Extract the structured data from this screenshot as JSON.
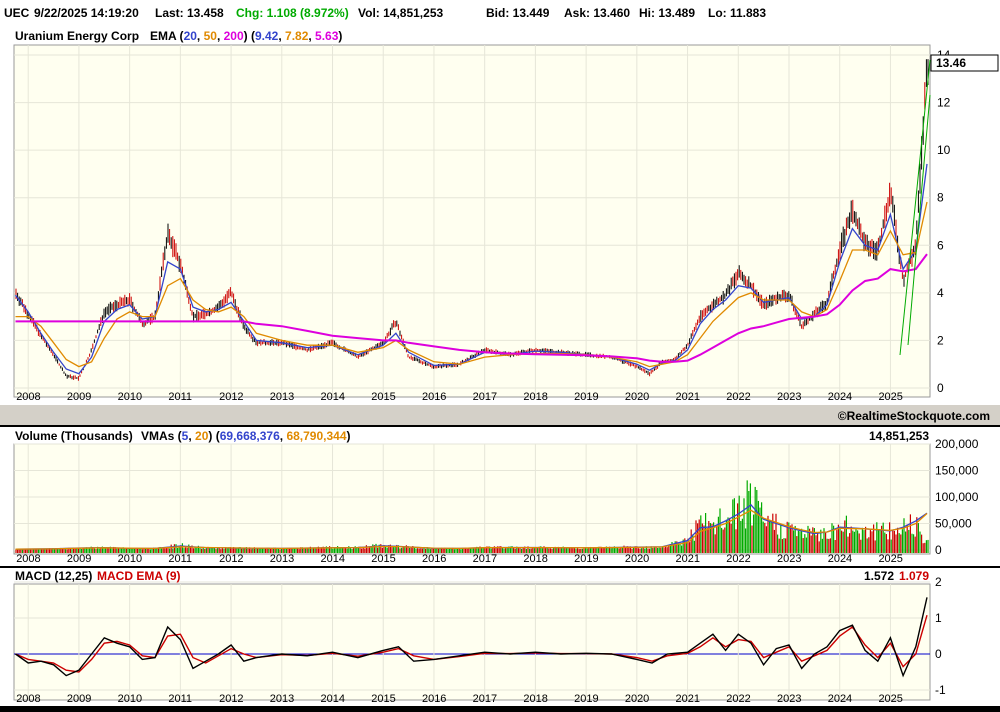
{
  "header": {
    "symbol": "UEC",
    "datetime": "9/22/2025 14:19:20",
    "last": "Last: 13.458",
    "chg": "Chg: 1.108 (8.972%)",
    "vol": "Vol: 14,851,253",
    "bid": "Bid: 13.449",
    "ask": "Ask: 13.460",
    "hi": "Hi: 13.489",
    "lo": "Lo: 11.883"
  },
  "colors": {
    "up": "#00aa00",
    "down": "#cc0000",
    "bar": "#000000",
    "ema20": "#3344cc",
    "ema50": "#e08a00",
    "ema200": "#dd00dd",
    "macd": "#000000",
    "macd_signal": "#cc0000",
    "zero_line": "#0000cc",
    "divider": "#d4d0c8"
  },
  "price_panel": {
    "company": "Uranium Energy Corp",
    "ema_label": "EMA (",
    "ema_periods": [
      "20",
      "50",
      "200"
    ],
    "ema_values": [
      "9.42",
      "7.82",
      "5.63"
    ],
    "last_price_tag": "13.46",
    "y_ticks": [
      "0",
      "2",
      "4",
      "6",
      "8",
      "10",
      "12",
      "14"
    ]
  },
  "copyright": "©RealtimeStockquote.com",
  "volume_panel": {
    "title": "Volume (Thousands)",
    "vma_label": "VMAs (",
    "vma_periods": [
      "5",
      "20"
    ],
    "vma_values": [
      "69,668,376",
      "68,790,344"
    ],
    "last_volume": "14,851,253",
    "y_ticks": [
      "0",
      "50,000",
      "100,000",
      "150,000",
      "200,000"
    ]
  },
  "macd_panel": {
    "title": "MACD (12,25)",
    "signal_label": "MACD EMA (9)",
    "macd_value": "1.572",
    "signal_value": "1.079",
    "y_ticks": [
      "-1",
      "0",
      "1",
      "2"
    ]
  },
  "x_years": [
    "2008",
    "2009",
    "2010",
    "2011",
    "2012",
    "2013",
    "2014",
    "2015",
    "2016",
    "2017",
    "2018",
    "2019",
    "2020",
    "2021",
    "2022",
    "2023",
    "2024",
    "2025"
  ],
  "chart_data": [
    {
      "type": "line",
      "title": "Uranium Energy Corp",
      "x": [
        2007.75,
        2008.0,
        2008.25,
        2008.5,
        2008.75,
        2009.0,
        2009.25,
        2009.5,
        2009.75,
        2010.0,
        2010.25,
        2010.5,
        2010.75,
        2011.0,
        2011.25,
        2011.5,
        2011.75,
        2012.0,
        2012.25,
        2012.5,
        2013.0,
        2013.5,
        2014.0,
        2014.5,
        2015.0,
        2015.25,
        2015.5,
        2016.0,
        2016.5,
        2017.0,
        2017.5,
        2018.0,
        2018.5,
        2019.0,
        2019.5,
        2020.0,
        2020.25,
        2020.5,
        2020.75,
        2021.0,
        2021.25,
        2021.5,
        2021.75,
        2022.0,
        2022.25,
        2022.5,
        2022.75,
        2023.0,
        2023.25,
        2023.5,
        2023.75,
        2024.0,
        2024.25,
        2024.5,
        2024.75,
        2025.0,
        2025.25,
        2025.5,
        2025.72
      ],
      "ylim": [
        0,
        14
      ],
      "series": [
        {
          "name": "Price",
          "values": [
            4.0,
            3.1,
            2.2,
            1.4,
            0.5,
            0.4,
            1.6,
            3.2,
            3.5,
            3.7,
            2.7,
            3.0,
            6.5,
            5.2,
            3.0,
            3.1,
            3.4,
            4.0,
            2.6,
            1.9,
            1.9,
            1.6,
            1.9,
            1.3,
            1.9,
            2.8,
            1.3,
            0.9,
            1.0,
            1.6,
            1.4,
            1.6,
            1.5,
            1.4,
            1.3,
            0.9,
            0.6,
            1.1,
            1.2,
            1.8,
            3.0,
            3.5,
            3.9,
            4.8,
            4.3,
            3.5,
            3.8,
            3.9,
            2.6,
            3.1,
            3.6,
            5.8,
            7.5,
            6.0,
            5.8,
            8.3,
            4.5,
            6.0,
            13.46
          ]
        },
        {
          "name": "EMA 20",
          "values": [
            3.9,
            3.2,
            2.3,
            1.5,
            0.8,
            0.6,
            1.3,
            2.8,
            3.3,
            3.5,
            2.9,
            3.0,
            5.3,
            5.0,
            3.4,
            3.2,
            3.3,
            3.6,
            2.8,
            2.0,
            1.9,
            1.7,
            1.8,
            1.4,
            1.8,
            2.3,
            1.5,
            0.95,
            1.0,
            1.5,
            1.4,
            1.55,
            1.5,
            1.4,
            1.3,
            1.0,
            0.75,
            1.05,
            1.15,
            1.6,
            2.7,
            3.3,
            3.7,
            4.3,
            4.2,
            3.6,
            3.7,
            3.8,
            2.9,
            3.0,
            3.5,
            5.3,
            6.7,
            6.0,
            5.8,
            7.3,
            5.0,
            5.8,
            9.42
          ]
        },
        {
          "name": "EMA 50",
          "values": [
            3.0,
            3.0,
            2.6,
            1.9,
            1.2,
            0.9,
            1.1,
            2.1,
            2.9,
            3.2,
            3.0,
            3.0,
            4.3,
            4.6,
            3.7,
            3.3,
            3.2,
            3.4,
            3.0,
            2.3,
            2.0,
            1.8,
            1.8,
            1.5,
            1.7,
            2.0,
            1.6,
            1.1,
            1.0,
            1.3,
            1.4,
            1.45,
            1.45,
            1.4,
            1.3,
            1.1,
            0.9,
            1.0,
            1.1,
            1.4,
            2.1,
            2.8,
            3.3,
            3.8,
            4.0,
            3.7,
            3.7,
            3.7,
            3.2,
            3.0,
            3.3,
            4.5,
            5.8,
            5.8,
            5.6,
            6.6,
            5.6,
            5.7,
            7.82
          ]
        },
        {
          "name": "EMA 200",
          "values": [
            2.8,
            2.8,
            2.8,
            2.8,
            2.8,
            2.8,
            2.8,
            2.8,
            2.8,
            2.8,
            2.8,
            2.8,
            2.8,
            2.8,
            2.8,
            2.8,
            2.8,
            2.8,
            2.8,
            2.7,
            2.6,
            2.4,
            2.2,
            2.1,
            2.0,
            2.0,
            1.9,
            1.75,
            1.6,
            1.5,
            1.45,
            1.42,
            1.4,
            1.38,
            1.33,
            1.25,
            1.15,
            1.1,
            1.1,
            1.15,
            1.4,
            1.7,
            2.0,
            2.3,
            2.5,
            2.6,
            2.75,
            2.9,
            2.95,
            3.0,
            3.1,
            3.5,
            4.1,
            4.5,
            4.6,
            5.0,
            4.9,
            5.0,
            5.63
          ]
        }
      ]
    },
    {
      "type": "bar",
      "title": "Volume (Thousands)",
      "x": [
        2007.75,
        2008.5,
        2009.0,
        2009.5,
        2010.0,
        2010.5,
        2011.0,
        2011.5,
        2012.0,
        2013.0,
        2014.0,
        2014.5,
        2015.0,
        2015.3,
        2016.0,
        2016.5,
        2017.0,
        2018.0,
        2019.0,
        2020.0,
        2020.5,
        2021.0,
        2021.25,
        2021.5,
        2021.75,
        2022.0,
        2022.25,
        2022.5,
        2022.75,
        2023.0,
        2023.25,
        2023.5,
        2023.75,
        2024.0,
        2024.5,
        2025.0,
        2025.25,
        2025.5,
        2025.72
      ],
      "ylim": [
        0,
        200000
      ],
      "series": [
        {
          "name": "Volume",
          "values": [
            1500,
            2500,
            4000,
            5000,
            3000,
            3000,
            9000,
            4000,
            4000,
            3000,
            5000,
            5000,
            9000,
            7000,
            3000,
            3000,
            5000,
            5000,
            4000,
            6000,
            6000,
            20000,
            50000,
            45000,
            60000,
            75000,
            95000,
            55000,
            50000,
            40000,
            35000,
            30000,
            35000,
            45000,
            40000,
            35000,
            45000,
            60000,
            14851
          ]
        },
        {
          "name": "VMA 5",
          "values": [
            1500,
            2300,
            3800,
            4600,
            3200,
            3000,
            7500,
            4500,
            3800,
            3000,
            4600,
            4800,
            8000,
            6800,
            3200,
            3000,
            4600,
            4700,
            4000,
            5500,
            6000,
            18000,
            42000,
            44000,
            55000,
            68000,
            85000,
            58000,
            50000,
            42000,
            36000,
            31000,
            34000,
            43000,
            40000,
            36000,
            43000,
            55000,
            69668
          ]
        },
        {
          "name": "VMA 20",
          "values": [
            1500,
            2100,
            3400,
            4200,
            3400,
            3100,
            6000,
            4800,
            3900,
            3100,
            4200,
            4600,
            6800,
            6500,
            3500,
            3100,
            4300,
            4500,
            4100,
            5000,
            5800,
            14000,
            35000,
            42000,
            50000,
            62000,
            75000,
            60000,
            52000,
            44000,
            38000,
            33000,
            34000,
            41000,
            40000,
            37000,
            41000,
            50000,
            68790
          ]
        }
      ]
    },
    {
      "type": "line",
      "title": "MACD (12,25)",
      "x": [
        2007.75,
        2008.0,
        2008.25,
        2008.5,
        2008.75,
        2009.0,
        2009.25,
        2009.5,
        2009.75,
        2010.0,
        2010.25,
        2010.5,
        2010.75,
        2011.0,
        2011.25,
        2011.5,
        2011.75,
        2012.0,
        2012.25,
        2012.5,
        2013.0,
        2013.5,
        2014.0,
        2014.5,
        2015.0,
        2015.3,
        2015.6,
        2016.0,
        2016.5,
        2017.0,
        2017.5,
        2018.0,
        2018.5,
        2019.0,
        2019.5,
        2020.0,
        2020.3,
        2020.6,
        2021.0,
        2021.25,
        2021.5,
        2021.75,
        2022.0,
        2022.25,
        2022.5,
        2022.75,
        2023.0,
        2023.25,
        2023.5,
        2023.75,
        2024.0,
        2024.25,
        2024.5,
        2024.75,
        2025.0,
        2025.25,
        2025.5,
        2025.72
      ],
      "ylim": [
        -1,
        2
      ],
      "series": [
        {
          "name": "MACD",
          "values": [
            0.0,
            -0.25,
            -0.2,
            -0.3,
            -0.6,
            -0.45,
            0.0,
            0.45,
            0.3,
            0.2,
            -0.15,
            -0.1,
            0.75,
            0.4,
            -0.4,
            -0.2,
            0.0,
            0.25,
            -0.2,
            -0.1,
            0.0,
            -0.05,
            0.05,
            -0.1,
            0.1,
            0.2,
            -0.2,
            -0.15,
            -0.05,
            0.05,
            0.0,
            0.05,
            0.0,
            0.02,
            0.0,
            -0.15,
            -0.25,
            0.0,
            0.05,
            0.3,
            0.55,
            0.1,
            0.55,
            0.3,
            -0.3,
            0.15,
            0.25,
            -0.4,
            0.0,
            0.2,
            0.65,
            0.8,
            0.1,
            -0.2,
            0.45,
            -0.6,
            0.2,
            1.572
          ]
        },
        {
          "name": "MACD EMA (9)",
          "values": [
            0.0,
            -0.15,
            -0.2,
            -0.25,
            -0.45,
            -0.5,
            -0.15,
            0.3,
            0.35,
            0.25,
            -0.05,
            -0.1,
            0.5,
            0.55,
            -0.1,
            -0.25,
            -0.05,
            0.15,
            0.0,
            -0.1,
            -0.02,
            -0.04,
            0.02,
            -0.06,
            0.05,
            0.15,
            -0.05,
            -0.15,
            -0.07,
            0.02,
            0.01,
            0.03,
            0.01,
            0.01,
            0.0,
            -0.1,
            -0.2,
            -0.05,
            0.02,
            0.2,
            0.45,
            0.2,
            0.4,
            0.35,
            -0.1,
            0.05,
            0.2,
            -0.2,
            -0.05,
            0.1,
            0.5,
            0.75,
            0.25,
            -0.1,
            0.3,
            -0.35,
            0.0,
            1.079
          ]
        }
      ]
    }
  ]
}
